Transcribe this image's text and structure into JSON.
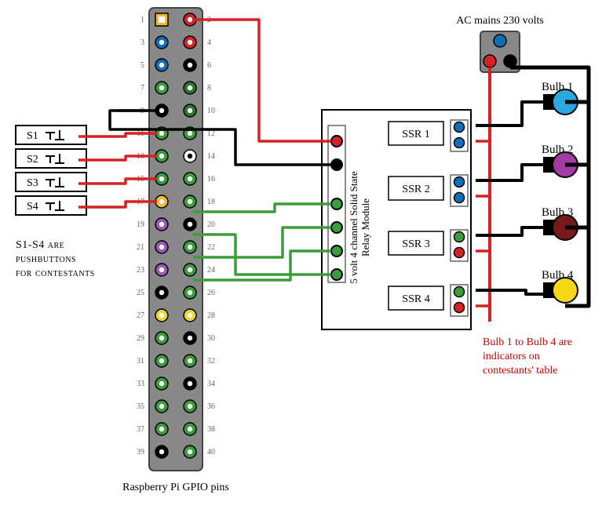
{
  "ac_label": "AC mains 230 volts",
  "pushbutton_caption_1": "S1-S4 are",
  "pushbutton_caption_2": "pushbuttons",
  "pushbutton_caption_3": "for contestants",
  "gpio_caption": "Raspberry Pi GPIO pins",
  "relay_caption_1": "5 volt 4 channel Solid State",
  "relay_caption_2": "Relay Module",
  "bulb_caption_1": "Bulb 1 to Bulb 4 are",
  "bulb_caption_2": "indicators on",
  "bulb_caption_3": "contestants' table",
  "switches": [
    "S1",
    "S2",
    "S3",
    "S4"
  ],
  "ssrs": [
    "SSR 1",
    "SSR 2",
    "SSR 3",
    "SSR 4"
  ],
  "bulbs": [
    "Bulb 1",
    "Bulb 2",
    "Bulb 3",
    "Bulb 4"
  ],
  "bulb_colors": [
    "#29a9df",
    "#a23ca2",
    "#7a1919",
    "#f4d716"
  ],
  "gpio_pin_count": 40,
  "gpio_left_colors": {
    "1": "#f7b733",
    "3": "#0e6fb8",
    "5": "#0e6fb8",
    "7": "#3a9d3a",
    "9": "#000",
    "11": "#3a9d3a",
    "13": "#3a9d3a",
    "15": "#3a9d3a",
    "17": "#f7b733",
    "19": "#9b59b6",
    "21": "#9b59b6",
    "23": "#9b59b6",
    "25": "#000",
    "27": "#e4d836",
    "29": "#3a9d3a",
    "31": "#3a9d3a",
    "33": "#3a9d3a",
    "35": "#3a9d3a",
    "37": "#3a9d3a",
    "39": "#000"
  },
  "gpio_right_colors": {
    "2": "#d62222",
    "4": "#d62222",
    "6": "#000",
    "8": "#2a7a2a",
    "10": "#2a7a2a",
    "12": "#3a9d3a",
    "14": "#fff",
    "16": "#3a9d3a",
    "18": "#3a9d3a",
    "20": "#000",
    "22": "#3a9d3a",
    "24": "#3a9d3a",
    "26": "#3a9d3a",
    "28": "#e4d836",
    "30": "#000",
    "32": "#3a9d3a",
    "34": "#000",
    "36": "#3a9d3a",
    "38": "#3a9d3a",
    "40": "#3a9d3a"
  }
}
